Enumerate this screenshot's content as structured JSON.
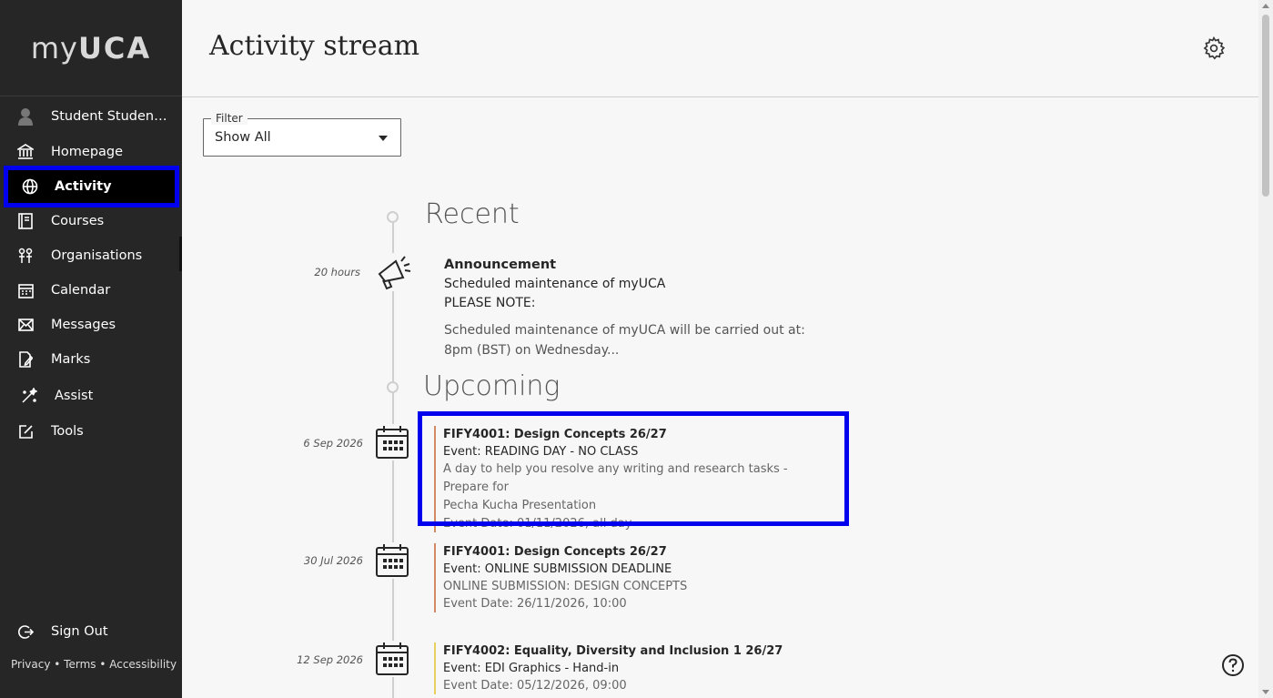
{
  "app": {
    "logo_prefix": "my",
    "logo_brand": "UCA"
  },
  "sidebar": {
    "items": [
      {
        "label": "Student Student...",
        "icon": "user-avatar-icon"
      },
      {
        "label": "Homepage",
        "icon": "institution-icon"
      },
      {
        "label": "Activity",
        "icon": "globe-icon"
      },
      {
        "label": "Courses",
        "icon": "book-icon"
      },
      {
        "label": "Organisations",
        "icon": "organisations-icon"
      },
      {
        "label": "Calendar",
        "icon": "calendar-icon"
      },
      {
        "label": "Messages",
        "icon": "envelope-icon"
      },
      {
        "label": "Marks",
        "icon": "marks-icon"
      },
      {
        "label": "Assist",
        "icon": "assist-icon"
      },
      {
        "label": "Tools",
        "icon": "tools-icon"
      }
    ],
    "sign_out": "Sign Out",
    "footer": {
      "privacy": "Privacy",
      "terms": "Terms",
      "accessibility": "Accessibility",
      "sep": " • "
    }
  },
  "header": {
    "title": "Activity stream"
  },
  "filter": {
    "label": "Filter",
    "value": "Show All"
  },
  "stream": {
    "recent_title": "Recent",
    "upcoming_title": "Upcoming",
    "announcement": {
      "time": "20 hours",
      "type": "Announcement",
      "subject": "Scheduled maintenance of myUCA",
      "note": "PLEASE NOTE:",
      "excerpt_1": "Scheduled maintenance of myUCA will be carried out at:",
      "excerpt_2": "8pm (BST) on Wednesday..."
    },
    "events": [
      {
        "time": "6 Sep 2026",
        "course": "FIFY4001: Design Concepts 26/27",
        "event": "Event: READING DAY - NO CLASS",
        "desc_1": "A day to help you resolve any writing and research tasks - Prepare for",
        "desc_2": "Pecha Kucha Presentation",
        "date": "Event Date: 01/11/2026, all day"
      },
      {
        "time": "30 Jul 2026",
        "course": "FIFY4001: Design Concepts 26/27",
        "event": "Event: ONLINE SUBMISSION DEADLINE",
        "desc_1": "ONLINE SUBMISSION: DESIGN CONCEPTS",
        "date": "Event Date: 26/11/2026, 10:00"
      },
      {
        "time": "12 Sep 2026",
        "course": "FIFY4002: Equality, Diversity and Inclusion 1 26/27",
        "event": "Event: EDI Graphics - Hand-in",
        "date": "Event Date: 05/12/2026, 09:00"
      }
    ]
  },
  "colors": {
    "sidebar_bg": "#262626",
    "highlight": "#0000ee",
    "event_accent_orange": "#d18a63",
    "event_accent_yellow": "#e8d060"
  }
}
